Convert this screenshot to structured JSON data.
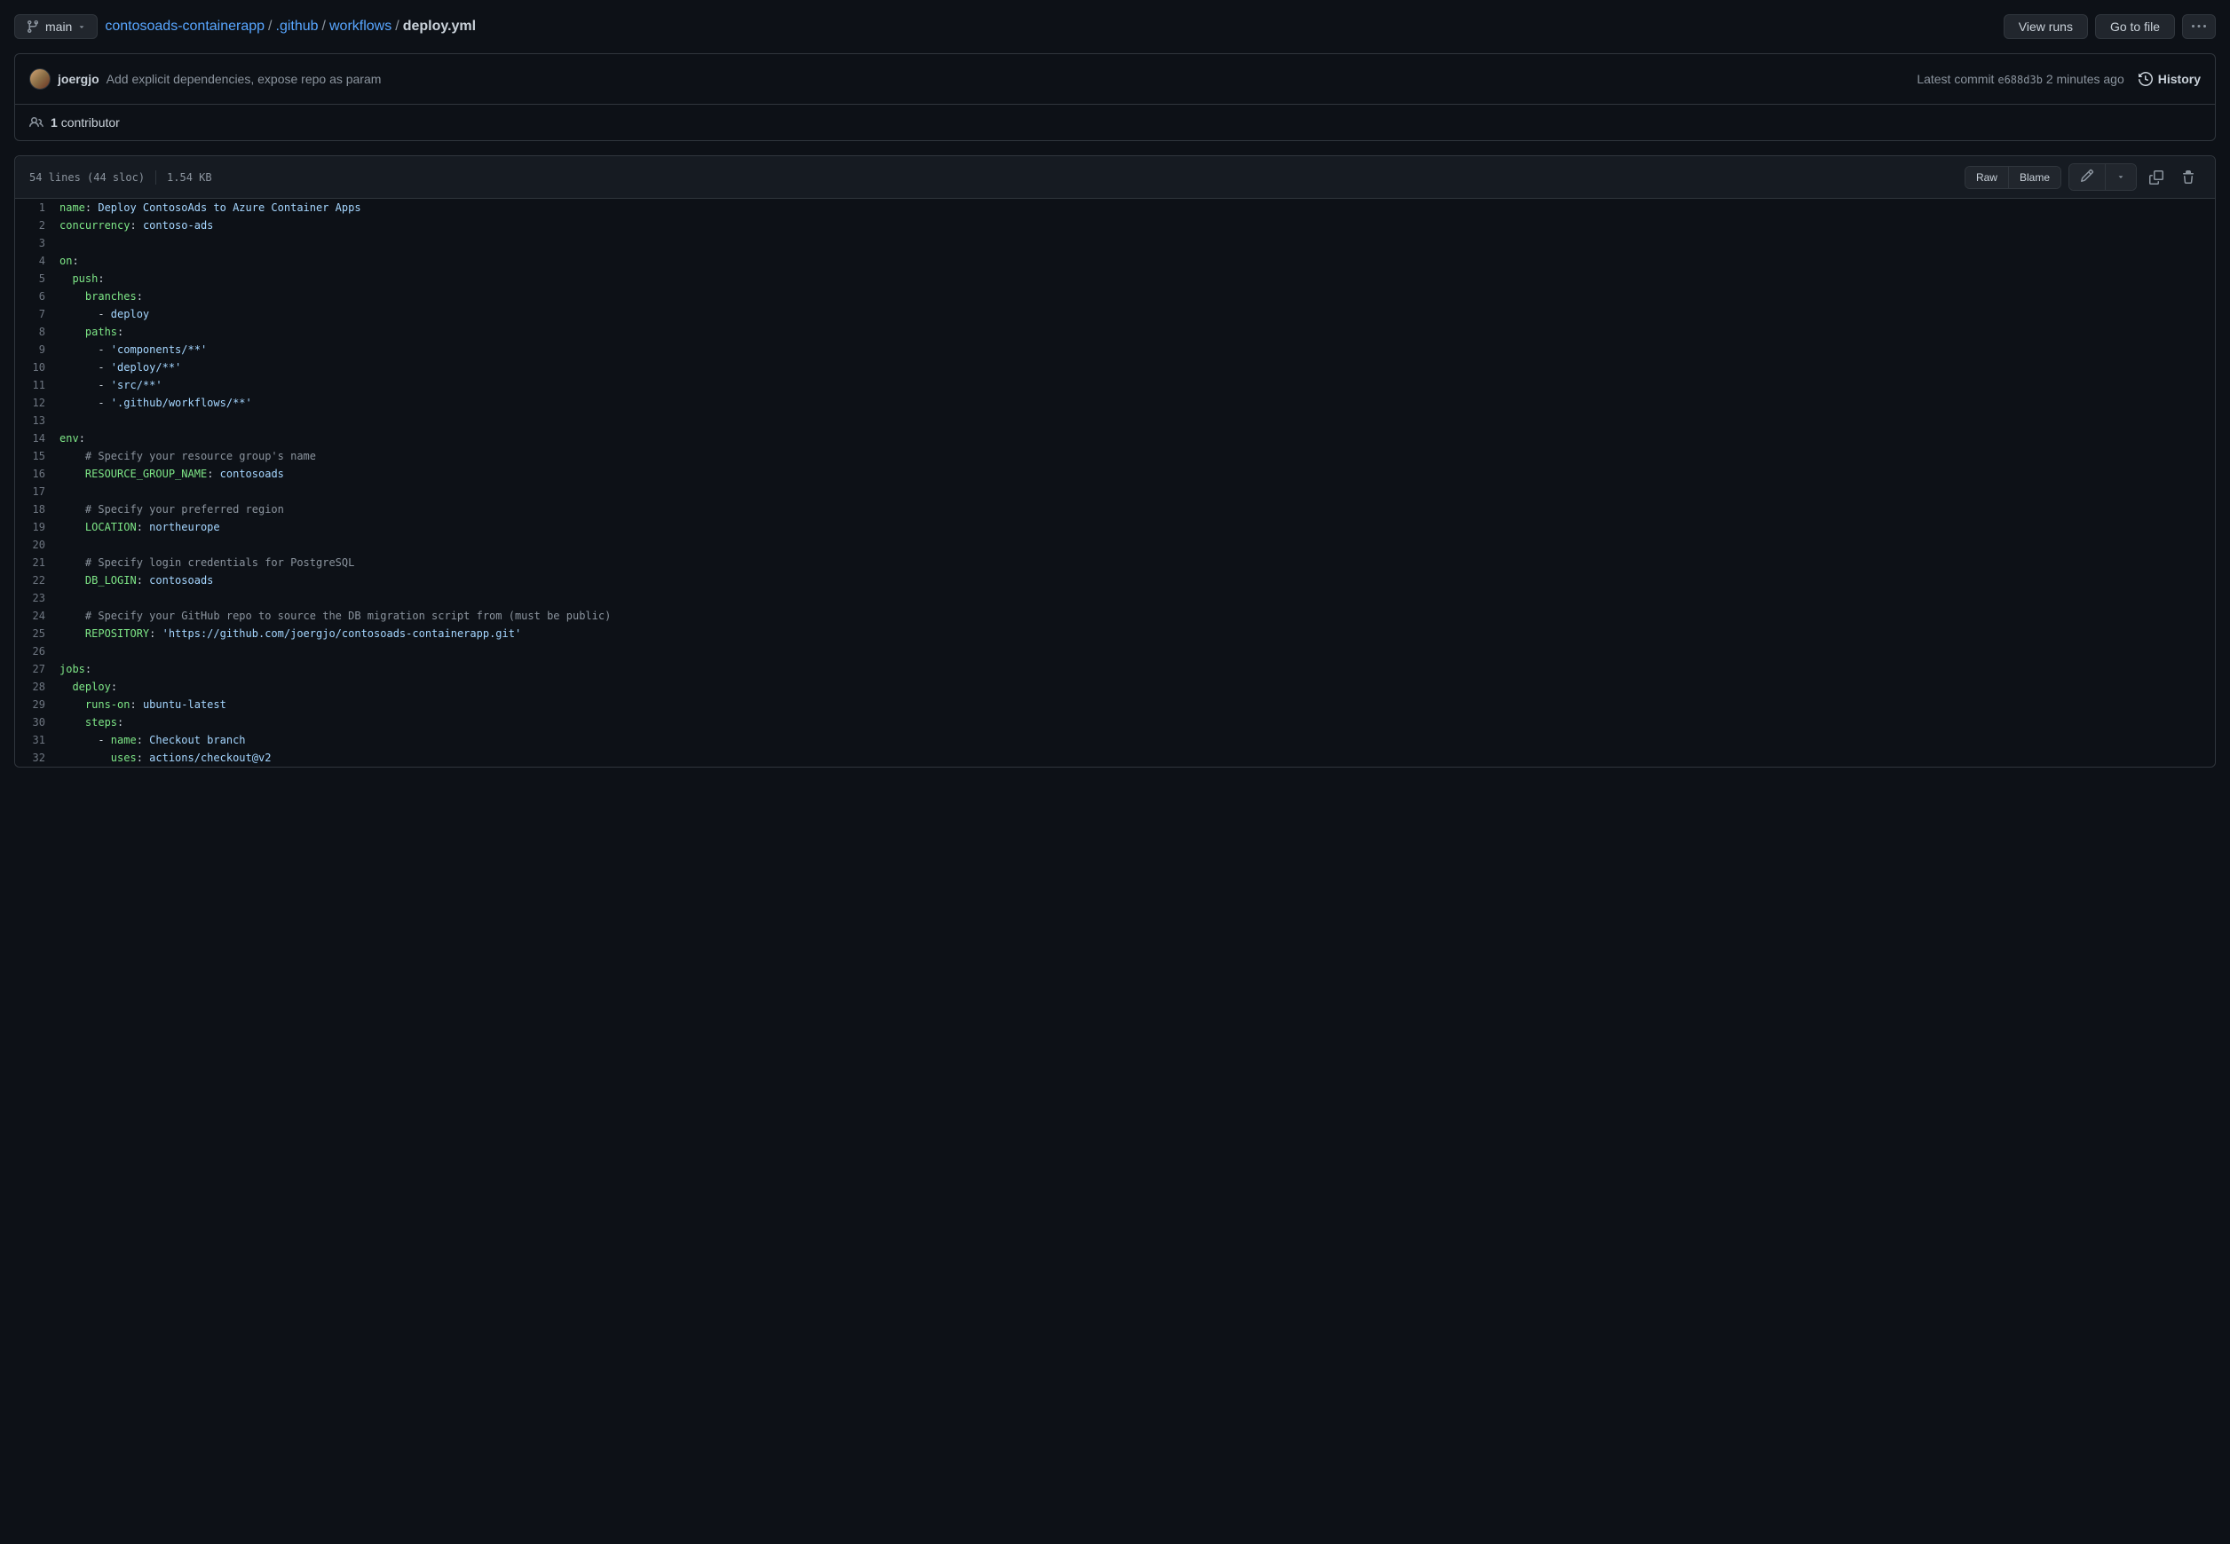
{
  "branch": {
    "label": "main"
  },
  "breadcrumb": {
    "repo": "contosoads-containerapp",
    "parts": [
      ".github",
      "workflows"
    ],
    "current": "deploy.yml"
  },
  "actions": {
    "view_runs": "View runs",
    "go_to_file": "Go to file"
  },
  "commit": {
    "author": "joergjo",
    "message": "Add explicit dependencies, expose repo as param",
    "latest_commit_label": "Latest commit",
    "sha": "e688d3b",
    "time": "2 minutes ago",
    "history": "History"
  },
  "contributors": {
    "count": "1",
    "label": "contributor"
  },
  "file": {
    "lines_sloc": "54 lines (44 sloc)",
    "size": "1.54 KB",
    "raw": "Raw",
    "blame": "Blame"
  },
  "code": [
    {
      "n": 1,
      "tokens": [
        {
          "t": "key",
          "v": "name"
        },
        {
          "t": "plain",
          "v": ": "
        },
        {
          "t": "str",
          "v": "Deploy ContosoAds to Azure Container Apps"
        }
      ]
    },
    {
      "n": 2,
      "tokens": [
        {
          "t": "key",
          "v": "concurrency"
        },
        {
          "t": "plain",
          "v": ": "
        },
        {
          "t": "str",
          "v": "contoso-ads"
        }
      ]
    },
    {
      "n": 3,
      "tokens": []
    },
    {
      "n": 4,
      "tokens": [
        {
          "t": "key",
          "v": "on"
        },
        {
          "t": "plain",
          "v": ":"
        }
      ]
    },
    {
      "n": 5,
      "tokens": [
        {
          "t": "plain",
          "v": "  "
        },
        {
          "t": "key",
          "v": "push"
        },
        {
          "t": "plain",
          "v": ":"
        }
      ]
    },
    {
      "n": 6,
      "tokens": [
        {
          "t": "plain",
          "v": "    "
        },
        {
          "t": "key",
          "v": "branches"
        },
        {
          "t": "plain",
          "v": ":"
        }
      ]
    },
    {
      "n": 7,
      "tokens": [
        {
          "t": "plain",
          "v": "      - "
        },
        {
          "t": "str",
          "v": "deploy"
        }
      ]
    },
    {
      "n": 8,
      "tokens": [
        {
          "t": "plain",
          "v": "    "
        },
        {
          "t": "key",
          "v": "paths"
        },
        {
          "t": "plain",
          "v": ":"
        }
      ]
    },
    {
      "n": 9,
      "tokens": [
        {
          "t": "plain",
          "v": "      - "
        },
        {
          "t": "str",
          "v": "'components/**'"
        }
      ]
    },
    {
      "n": 10,
      "tokens": [
        {
          "t": "plain",
          "v": "      - "
        },
        {
          "t": "str",
          "v": "'deploy/**'"
        }
      ]
    },
    {
      "n": 11,
      "tokens": [
        {
          "t": "plain",
          "v": "      - "
        },
        {
          "t": "str",
          "v": "'src/**'"
        }
      ]
    },
    {
      "n": 12,
      "tokens": [
        {
          "t": "plain",
          "v": "      - "
        },
        {
          "t": "str",
          "v": "'.github/workflows/**'"
        }
      ]
    },
    {
      "n": 13,
      "tokens": []
    },
    {
      "n": 14,
      "tokens": [
        {
          "t": "key",
          "v": "env"
        },
        {
          "t": "plain",
          "v": ":"
        }
      ]
    },
    {
      "n": 15,
      "tokens": [
        {
          "t": "plain",
          "v": "    "
        },
        {
          "t": "comment",
          "v": "# Specify your resource group's name"
        }
      ]
    },
    {
      "n": 16,
      "tokens": [
        {
          "t": "plain",
          "v": "    "
        },
        {
          "t": "key",
          "v": "RESOURCE_GROUP_NAME"
        },
        {
          "t": "plain",
          "v": ": "
        },
        {
          "t": "str",
          "v": "contosoads"
        }
      ]
    },
    {
      "n": 17,
      "tokens": []
    },
    {
      "n": 18,
      "tokens": [
        {
          "t": "plain",
          "v": "    "
        },
        {
          "t": "comment",
          "v": "# Specify your preferred region"
        }
      ]
    },
    {
      "n": 19,
      "tokens": [
        {
          "t": "plain",
          "v": "    "
        },
        {
          "t": "key",
          "v": "LOCATION"
        },
        {
          "t": "plain",
          "v": ": "
        },
        {
          "t": "str",
          "v": "northeurope"
        }
      ]
    },
    {
      "n": 20,
      "tokens": []
    },
    {
      "n": 21,
      "tokens": [
        {
          "t": "plain",
          "v": "    "
        },
        {
          "t": "comment",
          "v": "# Specify login credentials for PostgreSQL"
        }
      ]
    },
    {
      "n": 22,
      "tokens": [
        {
          "t": "plain",
          "v": "    "
        },
        {
          "t": "key",
          "v": "DB_LOGIN"
        },
        {
          "t": "plain",
          "v": ": "
        },
        {
          "t": "str",
          "v": "contosoads"
        }
      ]
    },
    {
      "n": 23,
      "tokens": []
    },
    {
      "n": 24,
      "tokens": [
        {
          "t": "plain",
          "v": "    "
        },
        {
          "t": "comment",
          "v": "# Specify your GitHub repo to source the DB migration script from (must be public)"
        }
      ]
    },
    {
      "n": 25,
      "tokens": [
        {
          "t": "plain",
          "v": "    "
        },
        {
          "t": "key",
          "v": "REPOSITORY"
        },
        {
          "t": "plain",
          "v": ": "
        },
        {
          "t": "str",
          "v": "'https://github.com/joergjo/contosoads-containerapp.git'"
        }
      ]
    },
    {
      "n": 26,
      "tokens": []
    },
    {
      "n": 27,
      "tokens": [
        {
          "t": "key",
          "v": "jobs"
        },
        {
          "t": "plain",
          "v": ":"
        }
      ]
    },
    {
      "n": 28,
      "tokens": [
        {
          "t": "plain",
          "v": "  "
        },
        {
          "t": "key",
          "v": "deploy"
        },
        {
          "t": "plain",
          "v": ":"
        }
      ]
    },
    {
      "n": 29,
      "tokens": [
        {
          "t": "plain",
          "v": "    "
        },
        {
          "t": "key",
          "v": "runs-on"
        },
        {
          "t": "plain",
          "v": ": "
        },
        {
          "t": "str",
          "v": "ubuntu-latest"
        }
      ]
    },
    {
      "n": 30,
      "tokens": [
        {
          "t": "plain",
          "v": "    "
        },
        {
          "t": "key",
          "v": "steps"
        },
        {
          "t": "plain",
          "v": ":"
        }
      ]
    },
    {
      "n": 31,
      "tokens": [
        {
          "t": "plain",
          "v": "      - "
        },
        {
          "t": "key",
          "v": "name"
        },
        {
          "t": "plain",
          "v": ": "
        },
        {
          "t": "str",
          "v": "Checkout branch"
        }
      ]
    },
    {
      "n": 32,
      "tokens": [
        {
          "t": "plain",
          "v": "        "
        },
        {
          "t": "key",
          "v": "uses"
        },
        {
          "t": "plain",
          "v": ": "
        },
        {
          "t": "str",
          "v": "actions/checkout@v2"
        }
      ]
    }
  ]
}
